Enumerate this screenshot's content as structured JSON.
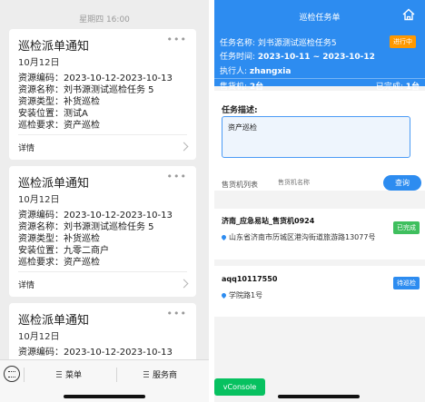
{
  "left": {
    "timestamp": "星期四 16:00",
    "cards": [
      {
        "title": "巡检派单通知",
        "date": "10月12日",
        "more": "•••",
        "rows": [
          "资源编码：2023-10-12-2023-10-13",
          "资源名称：刘书源测试巡检任务 5",
          "资源类型：补货巡检",
          "安装位置：测试A",
          "巡检要求：资产巡检"
        ],
        "detail": "详情"
      },
      {
        "title": "巡检派单通知",
        "date": "10月12日",
        "more": "•••",
        "rows": [
          "资源编码：2023-10-12-2023-10-13",
          "资源名称：刘书源测试巡检任务 5",
          "资源类型：补货巡检",
          "安装位置：九零二商户",
          "巡检要求：资产巡检"
        ],
        "detail": "详情"
      },
      {
        "title": "巡检派单通知",
        "date": "10月12日",
        "more": "•••",
        "rows": [
          "资源编码：2023-10-12-2023-10-13"
        ],
        "detail": ""
      }
    ],
    "bottom_bar": {
      "menu1": "菜单",
      "menu2": "服务商"
    }
  },
  "right": {
    "header_title": "巡检任务单",
    "task_name_label": "任务名称:",
    "task_name": "刘书源测试巡检任务5",
    "status": "进行中",
    "task_time_label": "任务时间:",
    "task_time": "2023-10-11 ~ 2023-10-12",
    "executor_label": "执行人:",
    "executor": "zhangxia",
    "vending_label": "售货机:",
    "vending_count": "2台",
    "completed_label": "已完成:",
    "completed_count": "1台",
    "desc_label": "任务描述:",
    "desc_text": "资产巡检",
    "list_label": "售货机列表",
    "search_placeholder": "售货机名称",
    "query_button": "查询",
    "machines": [
      {
        "name": "济南_应急易站_售货机0924",
        "address": "山东省济南市历城区港沟街道旅游路13077号",
        "status": "已完成"
      },
      {
        "name": "aqq10117550",
        "address": "学院路1号",
        "status": "待巡检"
      }
    ],
    "vconsole": "vConsole"
  },
  "colors": {
    "primary": "#2d8cf0",
    "status_orange": "#ff9800",
    "done_green": "#3fbf5e",
    "vconsole_green": "#07c160"
  }
}
